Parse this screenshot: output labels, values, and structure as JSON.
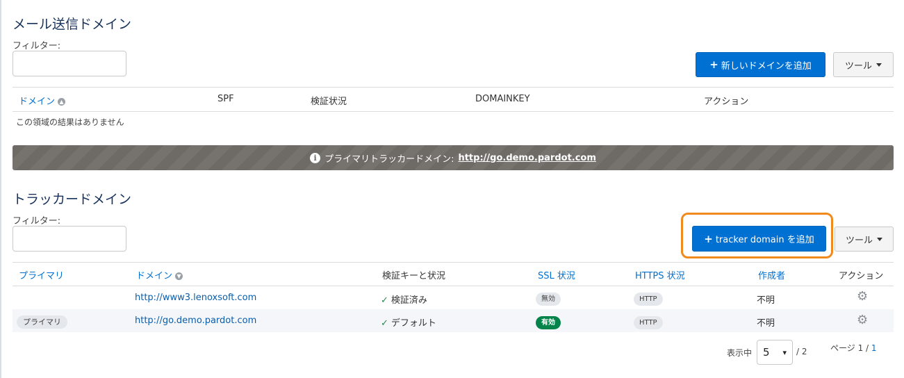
{
  "email_section": {
    "title": "メール送信ドメイン",
    "filter_label": "フィルター:",
    "filter_value": "",
    "add_button": "新しいドメインを追加",
    "tools_button": "ツール",
    "columns": [
      "ドメイン",
      "SPF",
      "検証状況",
      "DOMAINKEY",
      "アクション"
    ],
    "empty_message": "この領域の結果はありません"
  },
  "banner": {
    "text": "プライマリトラッカードメイン:",
    "link": "http://go.demo.pardot.com"
  },
  "tracker_section": {
    "title": "トラッカードメイン",
    "filter_label": "フィルター:",
    "filter_value": "",
    "add_button": "tracker domain を追加",
    "tools_button": "ツール",
    "columns": [
      "プライマリ",
      "ドメイン",
      "検証キーと状況",
      "SSL 状況",
      "HTTPS 状況",
      "作成者",
      "アクション"
    ],
    "rows": [
      {
        "primary": "",
        "domain": "http://www3.lenoxsoft.com",
        "verification": "検証済み",
        "ssl": "無効",
        "https": "HTTP",
        "creator": "不明"
      },
      {
        "primary": "プライマリ",
        "domain": "http://go.demo.pardot.com",
        "verification": "デフォルト",
        "ssl": "有効",
        "https": "HTTP",
        "creator": "不明"
      }
    ]
  },
  "pagination": {
    "show_label": "表示中",
    "per_page": "5",
    "total_suffix": "/ 2",
    "page_label": "ページ 1 /",
    "page_total": "1"
  },
  "colors": {
    "primary": "#0070d2",
    "highlight": "#f08a1c",
    "success": "#04844b"
  }
}
